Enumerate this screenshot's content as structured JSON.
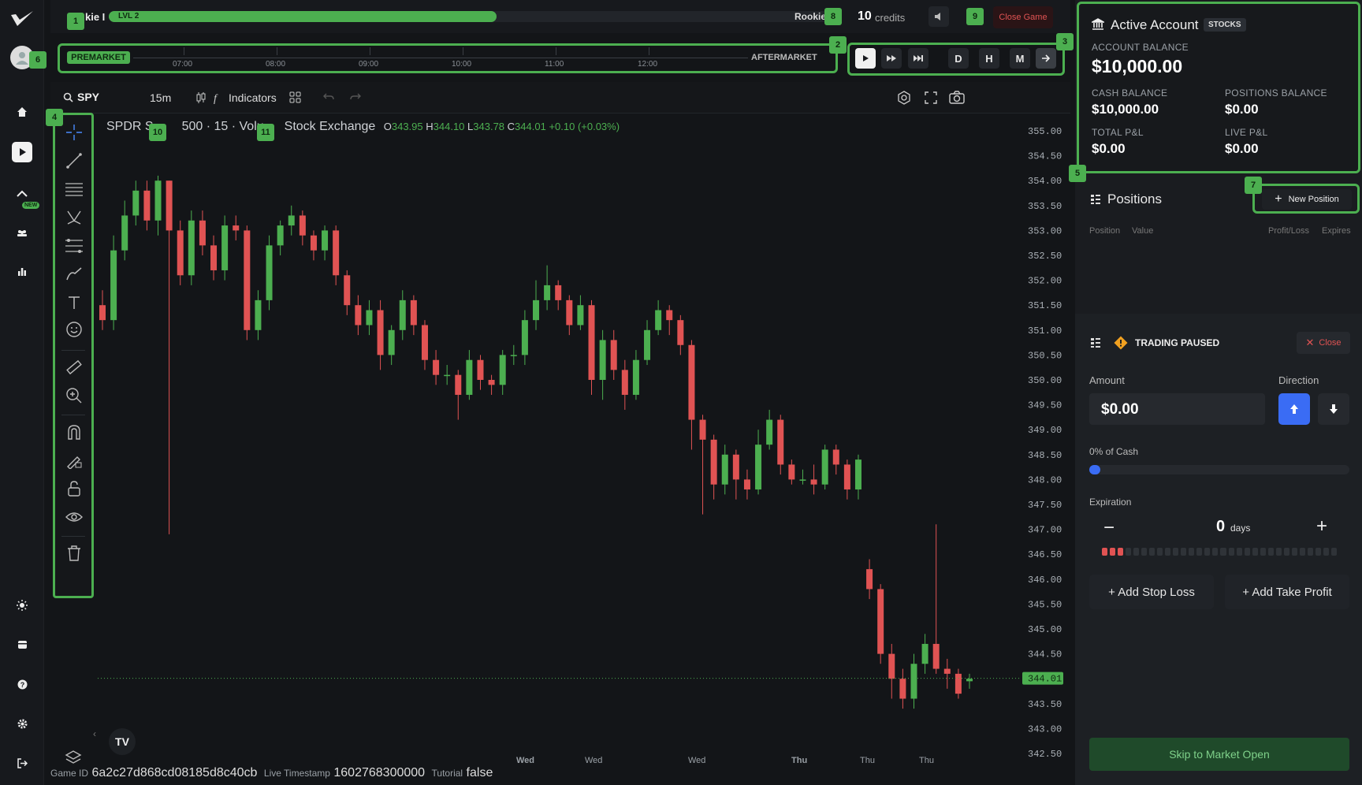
{
  "app": {
    "logo": "logo-icon"
  },
  "topbar": {
    "level_name": "kie I",
    "level": "LVL 2",
    "progress": 0.53,
    "rank": "Rookie",
    "credits_num": "10",
    "credits_label": "credits",
    "close_game": "Close Game"
  },
  "badges": [
    "1",
    "2",
    "3",
    "4",
    "5",
    "6",
    "7",
    "8",
    "9",
    "10",
    "11"
  ],
  "timeline": {
    "premarket": "PREMARKET",
    "aftermarket": "AFTERMARKET",
    "times": [
      "07:00",
      "08:00",
      "09:00",
      "10:00",
      "11:00",
      "12:00"
    ]
  },
  "controls": {
    "labels": [
      "D",
      "H",
      "M"
    ]
  },
  "chart_toolbar": {
    "symbol": "SPY",
    "interval": "15m",
    "indicators": "Indicators"
  },
  "legend": {
    "title_a": "SPDR S",
    "title_b": "500 · 15 · Volu",
    "title_c": "Stock Exchange",
    "o_label": "O",
    "o": "343.95",
    "h_label": "H",
    "h": "344.10",
    "l_label": "L",
    "l": "343.78",
    "c_label": "C",
    "c": "344.01",
    "chg": "+0.10 (+0.03%)"
  },
  "price_axis": [
    "355.00",
    "354.50",
    "354.00",
    "353.50",
    "353.00",
    "352.50",
    "352.00",
    "351.50",
    "351.00",
    "350.50",
    "350.00",
    "349.50",
    "349.00",
    "348.50",
    "348.00",
    "347.50",
    "347.00",
    "346.50",
    "346.00",
    "345.50",
    "345.00",
    "344.50",
    "344.01",
    "343.50",
    "343.00",
    "342.50"
  ],
  "time_axis": [
    "Wed",
    "Wed",
    "Wed",
    "Thu",
    "Thu",
    "Thu"
  ],
  "footer": {
    "game_id_label": "Game ID",
    "game_id": "6a2c27d868cd08185d8c40cb",
    "ts_label": "Live Timestamp",
    "ts": "1602768300000",
    "tut_label": "Tutorial",
    "tut": "false"
  },
  "account": {
    "title": "Active Account",
    "tag": "STOCKS",
    "balance_label": "ACCOUNT BALANCE",
    "balance": "$10,000.00",
    "cash_label": "CASH BALANCE",
    "cash": "$10,000.00",
    "pos_label": "POSITIONS BALANCE",
    "pos": "$0.00",
    "pnl_label": "TOTAL P&L",
    "pnl": "$0.00",
    "live_label": "LIVE P&L",
    "live": "$0.00"
  },
  "positions": {
    "title": "Positions",
    "new_btn": "New Position",
    "cols": [
      "Position",
      "Value",
      "Profit/Loss",
      "Expires"
    ]
  },
  "trade": {
    "status": "TRADING PAUSED",
    "close": "Close",
    "amount_label": "Amount",
    "amount": "$0.00",
    "direction_label": "Direction",
    "cash_pct": "0% of Cash",
    "expiration_label": "Expiration",
    "days": "0",
    "days_unit": "days",
    "stop_loss": "+ Add Stop Loss",
    "take_profit": "+ Add Take Profit",
    "skip": "Skip to Market Open"
  },
  "chart_data": {
    "type": "candlestick",
    "symbol": "SPY",
    "interval": "15m",
    "ylim": [
      342.5,
      355.0
    ],
    "last": 344.01,
    "close": [
      351.2,
      352.6,
      353.3,
      353.8,
      353.2,
      354.0,
      353.0,
      352.1,
      353.2,
      352.7,
      352.2,
      353.1,
      353.0,
      351.0,
      351.6,
      352.7,
      353.1,
      353.3,
      352.9,
      352.6,
      353.0,
      352.1,
      351.5,
      351.1,
      351.4,
      350.5,
      351.0,
      351.6,
      351.1,
      350.4,
      350.1,
      350.1,
      349.7,
      350.4,
      350.0,
      349.9,
      350.5,
      350.5,
      351.2,
      351.6,
      351.9,
      351.6,
      351.1,
      351.5,
      350.0,
      350.8,
      350.2,
      349.7,
      350.4,
      351.0,
      351.4,
      351.2,
      350.7,
      349.2,
      348.8,
      347.9,
      348.5,
      348.0,
      347.8,
      348.7,
      349.2,
      348.3,
      348.0,
      348.0,
      347.9,
      348.6,
      348.3,
      347.8,
      348.4,
      345.8,
      344.5,
      344.0,
      343.6,
      344.3,
      344.7,
      344.2,
      344.1,
      343.7,
      344.0
    ],
    "open": [
      351.5,
      351.2,
      352.6,
      353.3,
      353.8,
      353.2,
      354.0,
      353.0,
      352.1,
      353.2,
      352.7,
      352.2,
      353.1,
      353.0,
      351.0,
      351.6,
      352.7,
      353.1,
      353.3,
      352.9,
      352.6,
      353.0,
      352.1,
      351.5,
      351.1,
      351.4,
      350.5,
      351.0,
      351.6,
      351.1,
      350.4,
      350.1,
      350.1,
      349.7,
      350.4,
      350.0,
      349.9,
      350.5,
      350.5,
      351.2,
      351.6,
      351.9,
      351.6,
      351.1,
      351.5,
      350.0,
      350.8,
      350.2,
      349.7,
      350.4,
      351.0,
      351.4,
      351.2,
      350.7,
      349.2,
      348.8,
      347.9,
      348.5,
      348.0,
      347.8,
      348.7,
      349.2,
      348.3,
      348.0,
      348.0,
      347.9,
      348.6,
      348.3,
      347.8,
      346.2,
      345.8,
      344.5,
      344.0,
      343.6,
      344.3,
      344.7,
      344.2,
      344.1,
      343.95
    ],
    "high": [
      351.8,
      352.9,
      353.6,
      354.0,
      354.0,
      354.1,
      354.0,
      353.2,
      353.4,
      353.4,
      352.9,
      353.3,
      353.3,
      353.1,
      351.8,
      352.9,
      353.2,
      353.5,
      353.4,
      353.0,
      353.1,
      353.1,
      352.2,
      351.7,
      351.6,
      351.6,
      351.1,
      351.8,
      351.7,
      351.2,
      350.6,
      350.3,
      350.2,
      350.6,
      350.5,
      350.1,
      350.6,
      350.7,
      351.4,
      352.0,
      352.3,
      352.0,
      351.7,
      351.7,
      351.6,
      351.0,
      351.0,
      350.4,
      350.6,
      351.2,
      351.6,
      351.5,
      351.3,
      350.8,
      349.3,
      348.9,
      348.7,
      348.6,
      348.2,
      349.0,
      349.4,
      349.3,
      348.4,
      348.2,
      348.3,
      348.7,
      348.7,
      348.4,
      348.5,
      346.4,
      345.9,
      344.7,
      344.2,
      344.5,
      344.9,
      347.1,
      344.4,
      344.2,
      344.1
    ],
    "low": [
      351.0,
      351.0,
      352.4,
      353.1,
      353.0,
      352.9,
      346.9,
      351.9,
      351.9,
      352.5,
      352.0,
      352.0,
      352.8,
      350.8,
      350.8,
      351.4,
      352.5,
      352.9,
      352.7,
      352.4,
      352.4,
      351.9,
      351.3,
      350.9,
      350.9,
      350.2,
      350.3,
      350.8,
      350.9,
      350.2,
      349.9,
      349.9,
      349.2,
      349.6,
      349.8,
      349.7,
      349.7,
      350.3,
      350.3,
      351.0,
      351.4,
      351.4,
      350.9,
      351.0,
      349.7,
      349.6,
      350.0,
      349.4,
      349.6,
      350.3,
      350.9,
      350.9,
      350.5,
      348.6,
      347.3,
      347.6,
      347.7,
      347.6,
      347.6,
      347.7,
      348.6,
      348.1,
      347.9,
      347.9,
      347.7,
      347.8,
      348.1,
      347.6,
      347.6,
      345.6,
      344.3,
      343.6,
      343.4,
      343.4,
      344.1,
      344.1,
      343.8,
      343.6,
      343.8
    ]
  }
}
